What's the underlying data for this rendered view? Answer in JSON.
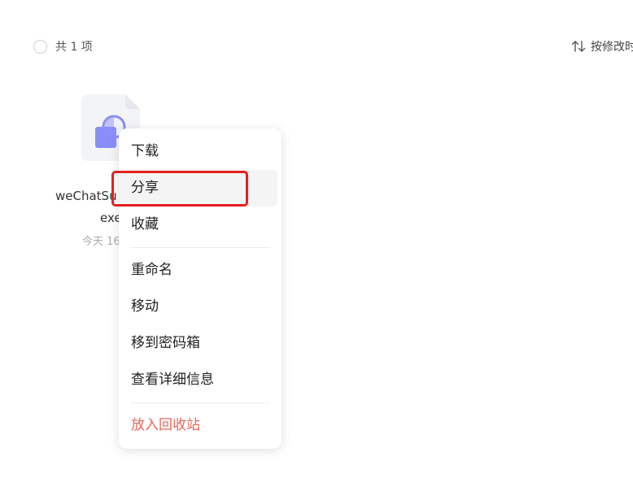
{
  "header": {
    "count_label": "共 1 项",
    "sort_label": "按修改时"
  },
  "file": {
    "name_line1": "weChatSu",
    "name_line2": "exe",
    "date": "今天 16",
    "icon": "exe-file-icon"
  },
  "context_menu": {
    "items": [
      {
        "label": "下载"
      },
      {
        "label": "分享"
      },
      {
        "label": "收藏"
      },
      {
        "label": "重命名"
      },
      {
        "label": "移动"
      },
      {
        "label": "移到密码箱"
      },
      {
        "label": "查看详细信息"
      },
      {
        "label": "放入回收站"
      }
    ]
  },
  "colors": {
    "danger": "#e8675b",
    "highlight": "#e32020",
    "file_icon_accent": "#7b7ff7"
  }
}
